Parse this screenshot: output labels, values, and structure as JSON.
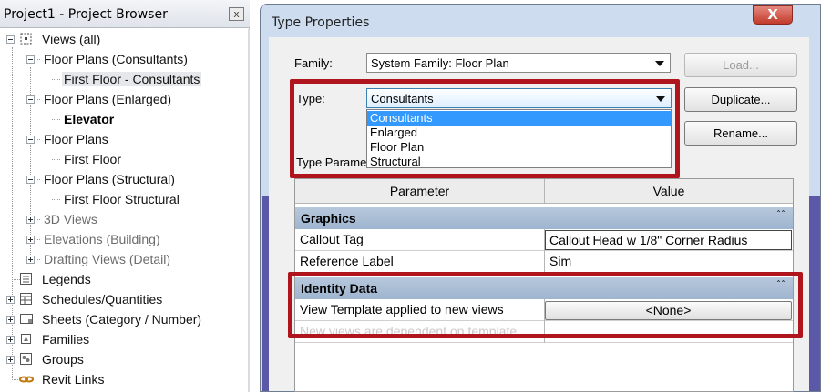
{
  "project_browser": {
    "title": "Project1 - Project Browser",
    "close_glyph": "x",
    "tree": [
      {
        "label": "Views (all)",
        "level": 0,
        "toggle": "minus",
        "icon": "views-icon"
      },
      {
        "label": "Floor Plans (Consultants)",
        "level": 1,
        "toggle": "minus"
      },
      {
        "label": "First Floor - Consultants",
        "level": 2,
        "state": "selected"
      },
      {
        "label": "Floor Plans (Enlarged)",
        "level": 1,
        "toggle": "minus"
      },
      {
        "label": "Elevator",
        "level": 2,
        "state": "bold"
      },
      {
        "label": "Floor Plans",
        "level": 1,
        "toggle": "minus"
      },
      {
        "label": "First Floor",
        "level": 2
      },
      {
        "label": "Floor Plans (Structural)",
        "level": 1,
        "toggle": "minus"
      },
      {
        "label": "First Floor Structural",
        "level": 2
      },
      {
        "label": "3D Views",
        "level": 1,
        "toggle": "plus",
        "state": "dim"
      },
      {
        "label": "Elevations (Building)",
        "level": 1,
        "toggle": "plus",
        "state": "dim"
      },
      {
        "label": "Drafting Views (Detail)",
        "level": 1,
        "toggle": "plus",
        "state": "dim"
      },
      {
        "label": "Legends",
        "level": 0,
        "icon": "legends-icon"
      },
      {
        "label": "Schedules/Quantities",
        "level": 0,
        "toggle": "plus",
        "icon": "schedules-icon"
      },
      {
        "label": "Sheets (Category / Number)",
        "level": 0,
        "toggle": "plus",
        "icon": "sheets-icon"
      },
      {
        "label": "Families",
        "level": 0,
        "toggle": "plus",
        "icon": "families-icon"
      },
      {
        "label": "Groups",
        "level": 0,
        "toggle": "plus",
        "icon": "groups-icon"
      },
      {
        "label": "Revit Links",
        "level": 0,
        "icon": "revit-links-icon"
      }
    ]
  },
  "dialog": {
    "title": "Type Properties",
    "close_glyph": "X",
    "family_label": "Family:",
    "family_value": "System Family: Floor Plan",
    "type_label": "Type:",
    "type_value": "Consultants",
    "load_button": "Load...",
    "duplicate_button": "Duplicate...",
    "rename_button": "Rename...",
    "type_parameters_label": "Type Paramet",
    "type_options": [
      "Consultants",
      "Enlarged",
      "Floor Plan",
      "Structural"
    ],
    "highlighted_option": "Consultants",
    "table": {
      "headers": [
        "Parameter",
        "Value"
      ],
      "groups": [
        {
          "name": "Graphics",
          "caret": "ˆˆ",
          "rows": [
            {
              "parameter": "Callout Tag",
              "value": "Callout Head w 1/8\" Corner Radius"
            },
            {
              "parameter": "Reference Label",
              "value": "Sim"
            }
          ]
        },
        {
          "name": "Identity Data",
          "caret": "ˆˆ",
          "rows": [
            {
              "parameter": "View Template applied to new views",
              "value": "<None>"
            },
            {
              "parameter": "New views are dependent on template",
              "value": ""
            }
          ]
        }
      ]
    },
    "highlight_color": "#b0151d",
    "selection_color": "#3399ff"
  }
}
